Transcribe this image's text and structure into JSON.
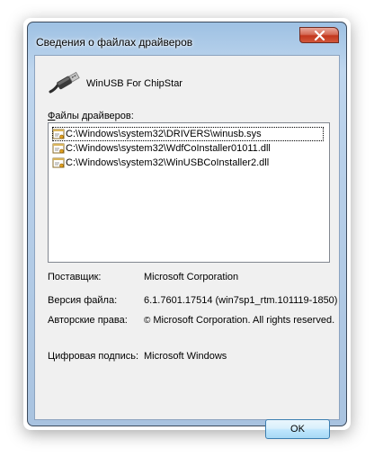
{
  "window": {
    "title": "Сведения о файлах драйверов"
  },
  "device": {
    "name": "WinUSB For ChipStar",
    "icon": "usb-cable-icon"
  },
  "files": {
    "label_accel": "Ф",
    "label_rest": "айлы драйверов:",
    "items": [
      "C:\\Windows\\system32\\DRIVERS\\winusb.sys",
      "C:\\Windows\\system32\\WdfCoInstaller01011.dll",
      "C:\\Windows\\system32\\WinUSBCoInstaller2.dll"
    ],
    "selected_index": 0
  },
  "info": {
    "provider_label": "Поставщик:",
    "provider_value": "Microsoft Corporation",
    "version_label": "Версия файла:",
    "version_value": "6.1.7601.17514 (win7sp1_rtm.101119-1850)",
    "copyright_label": "Авторские права:",
    "copyright_symbol": "©",
    "copyright_value": "Microsoft Corporation. All rights reserved.",
    "signer_label": "Цифровая подпись:",
    "signer_value": "Microsoft Windows"
  },
  "buttons": {
    "ok": "OK"
  },
  "colors": {
    "frame": "#b7cfe9",
    "close_red": "#c2371d",
    "client_bg": "#f0f0f0",
    "ok_border": "#3c7fb1"
  }
}
